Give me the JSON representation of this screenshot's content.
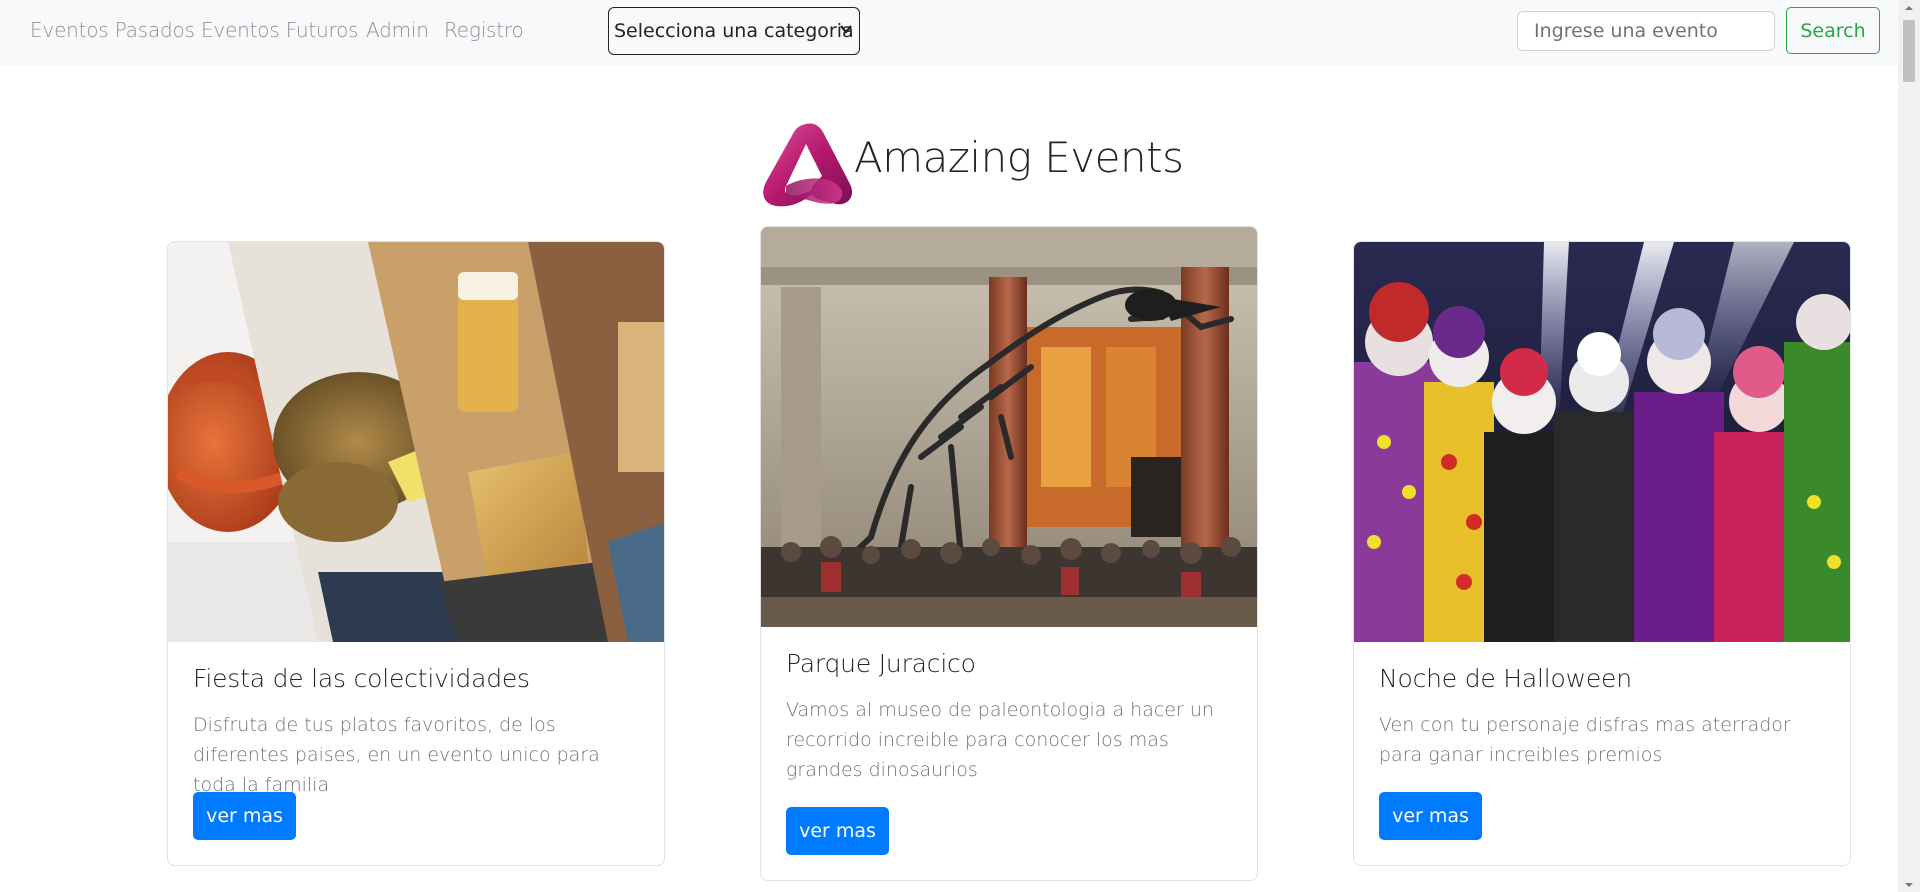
{
  "nav": {
    "links": [
      "Eventos Pasados",
      "Eventos Futuros",
      "Admin",
      "Registro"
    ],
    "category_select": "Selecciona una categoria",
    "search_placeholder": "Ingrese una evento",
    "search_button": "Search"
  },
  "header": {
    "title": "Amazing Events"
  },
  "cards": [
    {
      "title": "Fiesta de las colectividades",
      "text": "Disfruta de tus platos favoritos, de los diferentes paises, en un evento unico para toda la familia",
      "button": "ver mas"
    },
    {
      "title": "Parque Juracico",
      "text": "Vamos al museo de paleontologia a hacer un recorrido increible para conocer los mas grandes dinosaurios",
      "button": "ver mas"
    },
    {
      "title": "Noche de Halloween",
      "text": "Ven con tu personaje disfras mas aterrador para ganar increibles premios",
      "button": "ver mas"
    }
  ],
  "colors": {
    "primary": "#007bff",
    "success": "#28a745",
    "nav_bg": "#f8f9fa",
    "logo_magenta": "#b5186d"
  }
}
